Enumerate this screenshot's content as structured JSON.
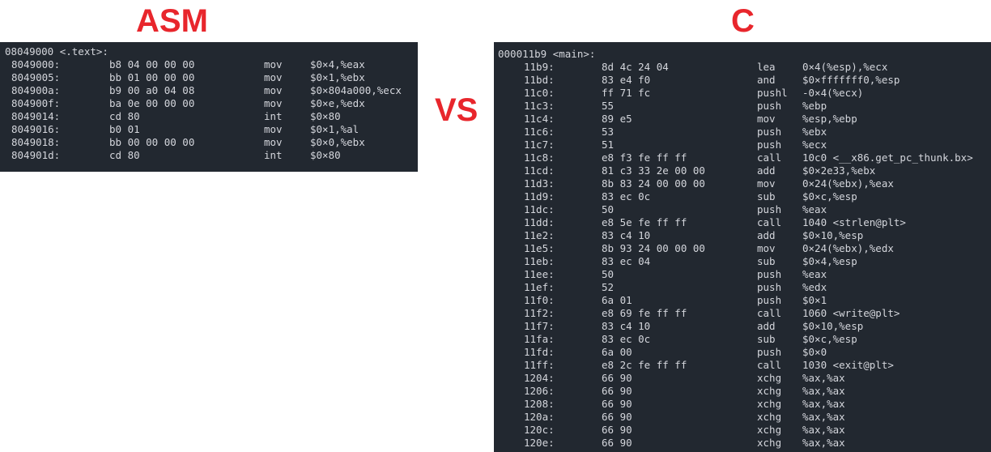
{
  "headings": {
    "left": "ASM",
    "right": "C",
    "versus": "VS"
  },
  "colors": {
    "heading": "#e8262c",
    "terminal_bg": "#222830",
    "terminal_text": "#d4d6dc"
  },
  "asm_panel": {
    "label": "08049000 <.text>:",
    "rows": [
      {
        "addr": "8049000:",
        "bytes": "b8 04 00 00 00",
        "mnem": "mov",
        "ops": "$0×4,%eax"
      },
      {
        "addr": "8049005:",
        "bytes": "bb 01 00 00 00",
        "mnem": "mov",
        "ops": "$0×1,%ebx"
      },
      {
        "addr": "804900a:",
        "bytes": "b9 00 a0 04 08",
        "mnem": "mov",
        "ops": "$0×804a000,%ecx"
      },
      {
        "addr": "804900f:",
        "bytes": "ba 0e 00 00 00",
        "mnem": "mov",
        "ops": "$0×e,%edx"
      },
      {
        "addr": "8049014:",
        "bytes": "cd 80",
        "mnem": "int",
        "ops": "$0×80"
      },
      {
        "addr": "8049016:",
        "bytes": "b0 01",
        "mnem": "mov",
        "ops": "$0×1,%al"
      },
      {
        "addr": "8049018:",
        "bytes": "bb 00 00 00 00",
        "mnem": "mov",
        "ops": "$0×0,%ebx"
      },
      {
        "addr": "804901d:",
        "bytes": "cd 80",
        "mnem": "int",
        "ops": "$0×80"
      }
    ]
  },
  "c_panel": {
    "label": "000011b9 <main>:",
    "rows": [
      {
        "addr": "11b9:",
        "bytes": "8d 4c 24 04",
        "mnem": "lea",
        "ops": "0×4(%esp),%ecx"
      },
      {
        "addr": "11bd:",
        "bytes": "83 e4 f0",
        "mnem": "and",
        "ops": "$0×fffffff0,%esp"
      },
      {
        "addr": "11c0:",
        "bytes": "ff 71 fc",
        "mnem": "pushl",
        "ops": "-0×4(%ecx)"
      },
      {
        "addr": "11c3:",
        "bytes": "55",
        "mnem": "push",
        "ops": "%ebp"
      },
      {
        "addr": "11c4:",
        "bytes": "89 e5",
        "mnem": "mov",
        "ops": "%esp,%ebp"
      },
      {
        "addr": "11c6:",
        "bytes": "53",
        "mnem": "push",
        "ops": "%ebx"
      },
      {
        "addr": "11c7:",
        "bytes": "51",
        "mnem": "push",
        "ops": "%ecx"
      },
      {
        "addr": "11c8:",
        "bytes": "e8 f3 fe ff ff",
        "mnem": "call",
        "ops": "10c0 <__x86.get_pc_thunk.bx>"
      },
      {
        "addr": "11cd:",
        "bytes": "81 c3 33 2e 00 00",
        "mnem": "add",
        "ops": "$0×2e33,%ebx"
      },
      {
        "addr": "11d3:",
        "bytes": "8b 83 24 00 00 00",
        "mnem": "mov",
        "ops": "0×24(%ebx),%eax"
      },
      {
        "addr": "11d9:",
        "bytes": "83 ec 0c",
        "mnem": "sub",
        "ops": "$0×c,%esp"
      },
      {
        "addr": "11dc:",
        "bytes": "50",
        "mnem": "push",
        "ops": "%eax"
      },
      {
        "addr": "11dd:",
        "bytes": "e8 5e fe ff ff",
        "mnem": "call",
        "ops": "1040 <strlen@plt>"
      },
      {
        "addr": "11e2:",
        "bytes": "83 c4 10",
        "mnem": "add",
        "ops": "$0×10,%esp"
      },
      {
        "addr": "11e5:",
        "bytes": "8b 93 24 00 00 00",
        "mnem": "mov",
        "ops": "0×24(%ebx),%edx"
      },
      {
        "addr": "11eb:",
        "bytes": "83 ec 04",
        "mnem": "sub",
        "ops": "$0×4,%esp"
      },
      {
        "addr": "11ee:",
        "bytes": "50",
        "mnem": "push",
        "ops": "%eax"
      },
      {
        "addr": "11ef:",
        "bytes": "52",
        "mnem": "push",
        "ops": "%edx"
      },
      {
        "addr": "11f0:",
        "bytes": "6a 01",
        "mnem": "push",
        "ops": "$0×1"
      },
      {
        "addr": "11f2:",
        "bytes": "e8 69 fe ff ff",
        "mnem": "call",
        "ops": "1060 <write@plt>"
      },
      {
        "addr": "11f7:",
        "bytes": "83 c4 10",
        "mnem": "add",
        "ops": "$0×10,%esp"
      },
      {
        "addr": "11fa:",
        "bytes": "83 ec 0c",
        "mnem": "sub",
        "ops": "$0×c,%esp"
      },
      {
        "addr": "11fd:",
        "bytes": "6a 00",
        "mnem": "push",
        "ops": "$0×0"
      },
      {
        "addr": "11ff:",
        "bytes": "e8 2c fe ff ff",
        "mnem": "call",
        "ops": "1030 <exit@plt>"
      },
      {
        "addr": "1204:",
        "bytes": "66 90",
        "mnem": "xchg",
        "ops": "%ax,%ax"
      },
      {
        "addr": "1206:",
        "bytes": "66 90",
        "mnem": "xchg",
        "ops": "%ax,%ax"
      },
      {
        "addr": "1208:",
        "bytes": "66 90",
        "mnem": "xchg",
        "ops": "%ax,%ax"
      },
      {
        "addr": "120a:",
        "bytes": "66 90",
        "mnem": "xchg",
        "ops": "%ax,%ax"
      },
      {
        "addr": "120c:",
        "bytes": "66 90",
        "mnem": "xchg",
        "ops": "%ax,%ax"
      },
      {
        "addr": "120e:",
        "bytes": "66 90",
        "mnem": "xchg",
        "ops": "%ax,%ax"
      }
    ]
  }
}
